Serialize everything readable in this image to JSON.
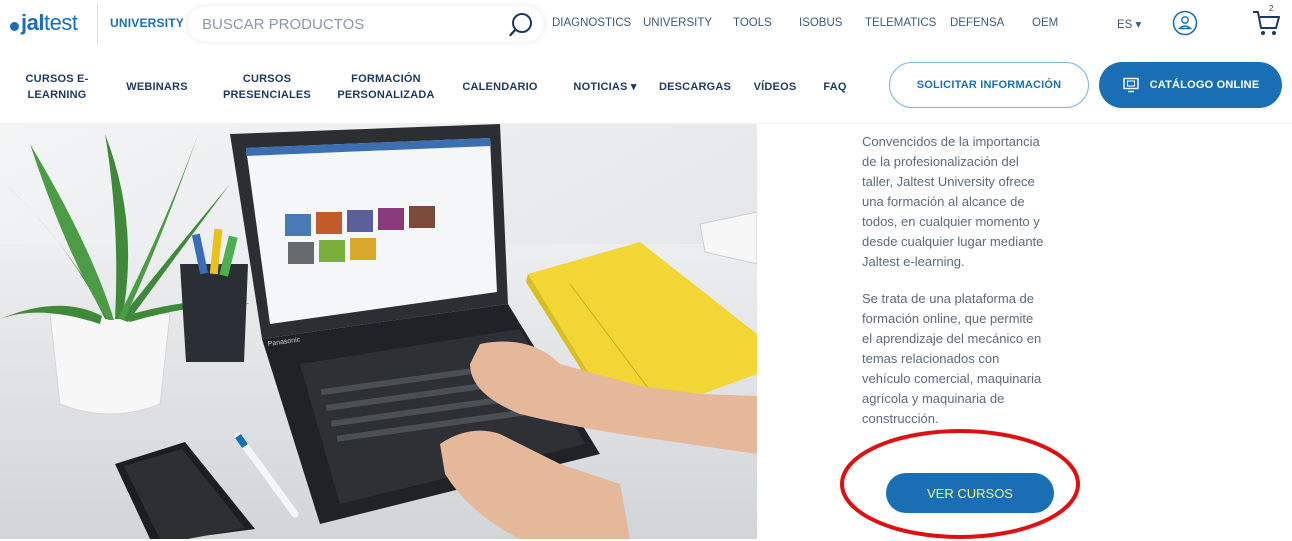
{
  "brand": {
    "logo_bold": "jal",
    "logo_light": "test",
    "university": "UNIVERSITY"
  },
  "search": {
    "placeholder": "BUSCAR PRODUCTOS"
  },
  "top_nav": [
    "DIAGNOSTICS",
    "UNIVERSITY",
    "TOOLS",
    "ISOBUS",
    "TELEMATICS",
    "DEFENSA",
    "OEM"
  ],
  "language": "ES ▾",
  "cart_count": "2",
  "main_nav": [
    {
      "line1": "CURSOS E-",
      "line2": "LEARNING"
    },
    {
      "line1": "WEBINARS",
      "line2": ""
    },
    {
      "line1": "CURSOS",
      "line2": "PRESENCIALES"
    },
    {
      "line1": "FORMACIÓN",
      "line2": "PERSONALIZADA"
    },
    {
      "line1": "CALENDARIO",
      "line2": ""
    },
    {
      "line1": "NOTICIAS ▾",
      "line2": ""
    },
    {
      "line1": "DESCARGAS",
      "line2": ""
    },
    {
      "line1": "VÍDEOS",
      "line2": ""
    },
    {
      "line1": "FAQ",
      "line2": ""
    }
  ],
  "buttons": {
    "request_info": "SOLICITAR INFORMACIÓN",
    "online_catalog": "CATÁLOGO ONLINE",
    "view_courses": "VER CURSOS"
  },
  "content": {
    "paragraph1": [
      "Convencidos de la importancia",
      "de la profesionalización del",
      "taller, Jaltest University ofrece",
      "una formación al alcance de",
      "todos, en cualquier momento y",
      "desde cualquier lugar mediante",
      "Jaltest e-learning."
    ],
    "paragraph2": [
      "Se trata de una plataforma de",
      "formación online, que permite",
      "el aprendizaje del mecánico en",
      "temas relacionados con",
      "vehículo comercial, maquinaria",
      "agrícola y maquinaria de",
      "construcción."
    ]
  },
  "laptop_brand": "Panasonic",
  "colors": {
    "brand_blue": "#1a6fb4",
    "annotation_red": "#e01010",
    "button_text": "#f4f47a"
  }
}
